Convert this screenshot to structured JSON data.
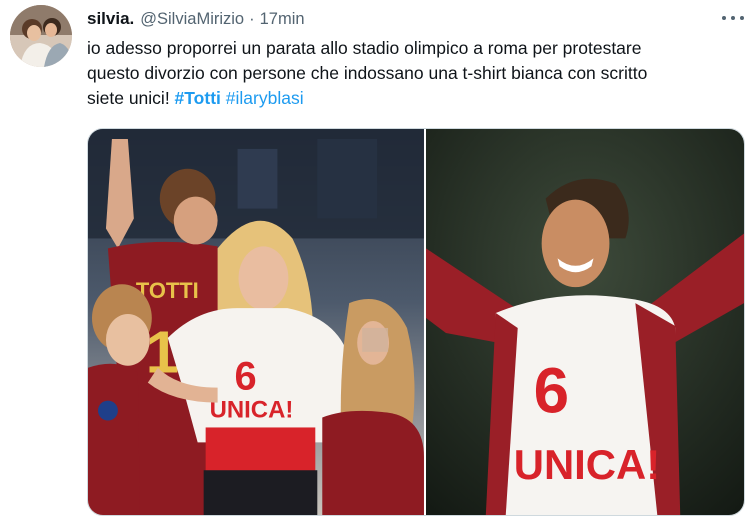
{
  "tweet": {
    "author_name": "silvia.",
    "author_handle": "@SilviaMirizio",
    "separator": "·",
    "timestamp": "17min",
    "text_line1": "io adesso proporrei un parata allo stadio olimpico a roma per protestare",
    "text_line2": "questo divorzio con persone che indossano una t-shirt bianca con scritto",
    "text_line3": "siete unici! ",
    "hashtags": [
      "#Totti",
      "#ilaryblasi"
    ],
    "more_icon": "more-horizontal-icon"
  },
  "media": {
    "left_photo": {
      "shirt_number": "6",
      "shirt_text": "UNICA!",
      "jersey_text": "TOTTI"
    },
    "right_photo": {
      "shirt_number": "6",
      "shirt_text": "UNICA!"
    }
  },
  "colors": {
    "accent": "#1d9bf0",
    "roma_red": "#8e1b22",
    "shirt_red": "#d8232a",
    "text_secondary": "#536471"
  }
}
